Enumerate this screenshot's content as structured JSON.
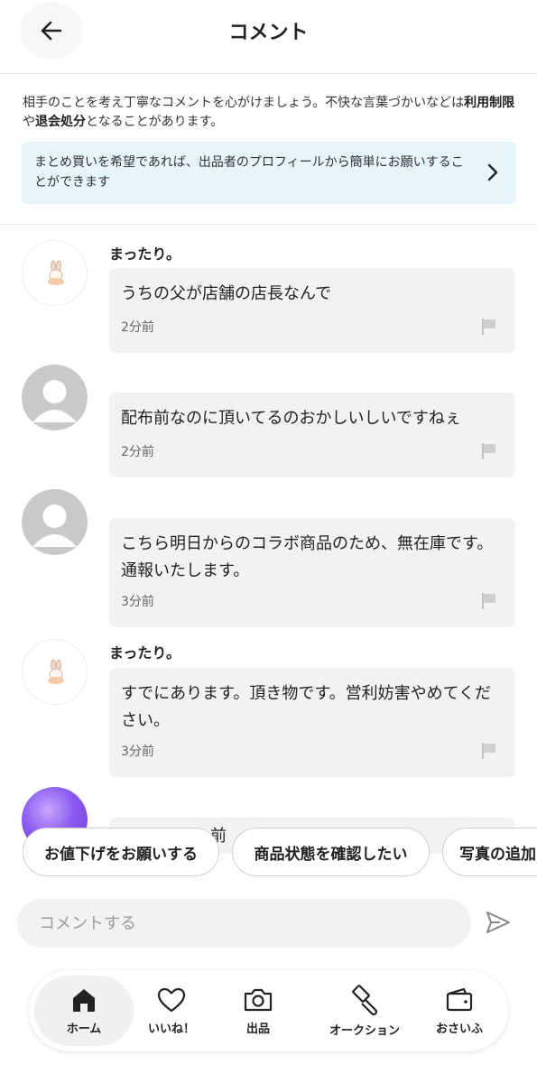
{
  "header": {
    "title": "コメント"
  },
  "notice": {
    "text_1": "相手のことを考え丁寧なコメントを心がけましょう。不快な言葉づかいなどは",
    "bold_1": "利用制限",
    "text_2": "や",
    "bold_2": "退会処分",
    "text_3": "となることがあります。"
  },
  "banner": {
    "text": "まとめ買いを希望であれば、出品者のプロフィールから簡単にお願いすることができます"
  },
  "comments": [
    {
      "user": "まったり。",
      "text": "うちの父が店舗の店長なんで",
      "time": "2分前"
    },
    {
      "user": "",
      "text": "配布前なのに頂いてるのおかしいしいですねぇ",
      "time": "2分前"
    },
    {
      "user": "",
      "text": "こちら明日からのコラボ商品のため、無在庫です。通報いたします。",
      "time": "3分前"
    },
    {
      "user": "まったり。",
      "text": "すでにあります。頂き物です。営利妨害やめてください。",
      "time": "3分前"
    },
    {
      "user": "",
      "text": "前",
      "time": ""
    }
  ],
  "chips": [
    "お値下げをお願いする",
    "商品状態を確認したい",
    "写真の追加"
  ],
  "comment_input": {
    "placeholder": "コメントする"
  },
  "tabs": [
    {
      "label": "ホーム",
      "icon": "home-icon"
    },
    {
      "label": "いいね！",
      "icon": "heart-icon"
    },
    {
      "label": "出品",
      "icon": "camera-icon"
    },
    {
      "label": "オークション",
      "icon": "gavel-icon"
    },
    {
      "label": "おさいふ",
      "icon": "wallet-icon"
    }
  ]
}
